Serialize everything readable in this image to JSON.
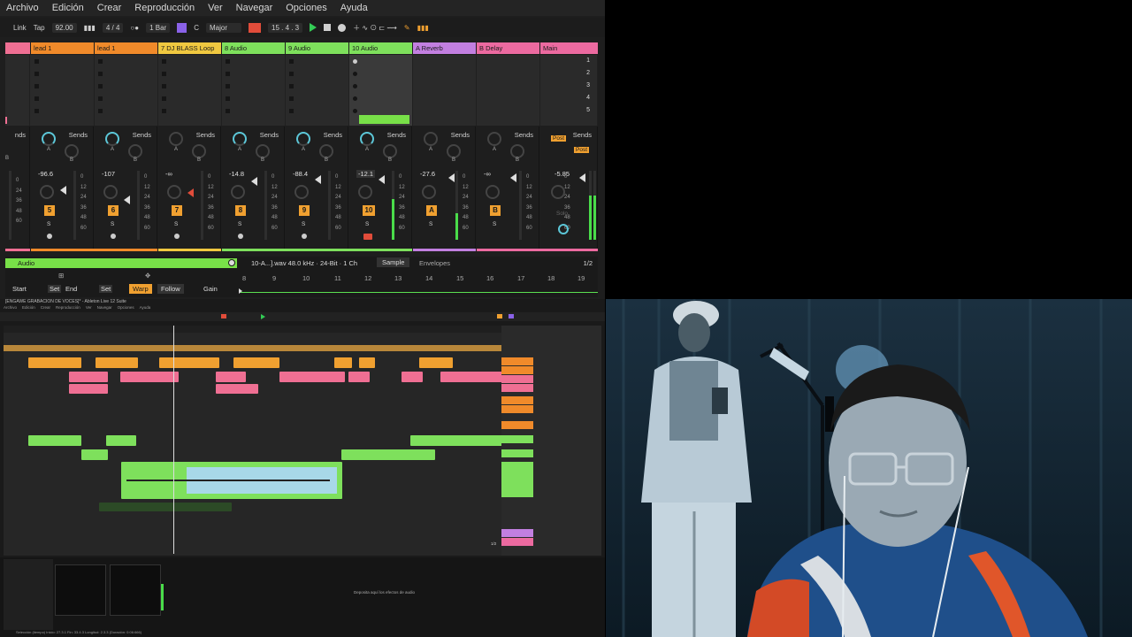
{
  "menu": [
    "Archivo",
    "Edición",
    "Crear",
    "Reproducción",
    "Ver",
    "Navegar",
    "Opciones",
    "Ayuda"
  ],
  "transport": {
    "link": "Link",
    "tap": "Tap",
    "tempo": "92.00",
    "signature": "4 / 4",
    "quantize": "1 Bar",
    "key": "C",
    "scale": "Major",
    "position": "15 .   4 .   3"
  },
  "tracks": [
    {
      "name": "",
      "color": "#ef6f93"
    },
    {
      "name": "lead 1",
      "color": "#f08a2a"
    },
    {
      "name": "lead 1",
      "color": "#f08a2a"
    },
    {
      "name": "7 DJ BLASS Loop",
      "color": "#f0c840"
    },
    {
      "name": "8 Audio",
      "color": "#7ee05c"
    },
    {
      "name": "9 Audio",
      "color": "#7ee05c"
    },
    {
      "name": "10 Audio",
      "color": "#7ee05c"
    },
    {
      "name": "A Reverb",
      "color": "#c27fe0"
    },
    {
      "name": "B Delay",
      "color": "#ec6aa0"
    },
    {
      "name": "Main",
      "color": "#ec6aa0"
    }
  ],
  "scenes": [
    "1",
    "2",
    "3",
    "4",
    "5"
  ],
  "mixer": {
    "sends_label": "Sends",
    "send_a": "A",
    "send_b": "B",
    "post_label": "Post",
    "solo_label": "Solo",
    "s_label": "S",
    "strips": [
      {
        "vol": "-96.6",
        "num": "5",
        "scale_top": "0"
      },
      {
        "vol": "-107",
        "num": "6",
        "scale_top": "0"
      },
      {
        "vol": "-∞",
        "num": "7",
        "scale_top": "0"
      },
      {
        "vol": "-14.8",
        "num": "8",
        "scale_top": "0"
      },
      {
        "vol": "-88.4",
        "num": "9",
        "scale_top": "0"
      },
      {
        "vol": "-12.1",
        "num": "10",
        "scale_top": "0"
      },
      {
        "vol": "-27.6",
        "num": "A",
        "scale_top": "0"
      },
      {
        "vol": "-∞",
        "num": "B",
        "scale_top": "0"
      },
      {
        "vol": "-5.85",
        "num": "",
        "scale_top": "0"
      }
    ],
    "partial_label": "nds",
    "scale_marks": [
      "12",
      "24",
      "36",
      "48",
      "60"
    ],
    "first_marks": [
      "0",
      "24",
      "36",
      "48",
      "60"
    ]
  },
  "clip": {
    "title": "Audio",
    "info": "10-A...].wav    48.0 kHz · 24-Bit · 1 Ch",
    "sample_tab": "Sample",
    "envelopes_tab": "Envelopes",
    "page": "1/2",
    "start": "Start",
    "set1": "Set",
    "end": "End",
    "set2": "Set",
    "warp": "Warp",
    "follow": "Follow",
    "gain": "Gain",
    "ruler": [
      "8",
      "9",
      "10",
      "11",
      "12",
      "13",
      "14",
      "15",
      "16",
      "17",
      "18",
      "19"
    ]
  },
  "arrangement": {
    "title": "[ENGAWE GRABACION DE VOCES]* - Ableton Live 12 Suite",
    "menu": [
      "Archivo",
      "Edición",
      "Crear",
      "Reproducción",
      "Ver",
      "Navegar",
      "Opciones",
      "Ayuda"
    ],
    "drop_text": "Deposita aquí los efectos de audio",
    "status": "Selección (tiempo)   Inicio: 27.3.1   Fin: 33.4.3   Longitud: 2.3.3 (Duración: 0:06:666)",
    "page": "1/2"
  },
  "colors": {
    "orange": "#f0a030",
    "green": "#7ee05c",
    "pink": "#ef6f93",
    "purple": "#c27fe0"
  }
}
